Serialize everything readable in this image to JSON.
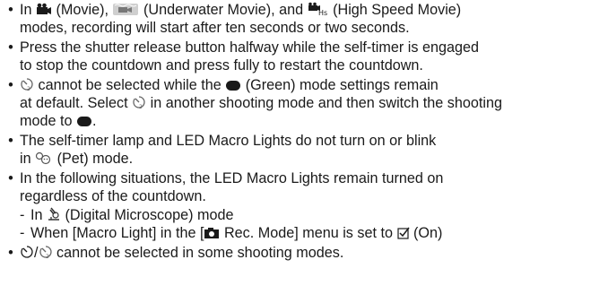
{
  "notes": {
    "bullet_char": "•",
    "dash_char": "-",
    "item1": {
      "a": "In",
      "b": "(Movie),",
      "c": "(Underwater Movie), and",
      "d": "(High Speed Movie)",
      "line2": "modes, recording will start after ten seconds or two seconds."
    },
    "item2": {
      "line1": "Press the shutter release button halfway while the self-timer is engaged",
      "line2": "to stop the countdown and press fully to restart the countdown."
    },
    "item3": {
      "a": "cannot be selected while the",
      "b": "(Green) mode settings remain",
      "line2": "at default. Select",
      "line2b": "in another shooting mode and then switch the shooting",
      "line3": "mode to",
      "line3b": "."
    },
    "item4": {
      "line1": "The self-timer lamp and LED Macro Lights do not turn on or blink",
      "line2a": "in",
      "line2b": "(Pet) mode."
    },
    "item5": {
      "line1": "In the following situations, the LED Macro Lights remain turned on",
      "line2": "regardless of the countdown.",
      "sub1a": "In",
      "sub1b": "(Digital Microscope) mode",
      "sub2a": "When [Macro Light] in the [",
      "sub2b": "Rec. Mode] menu is set to",
      "sub2c": "(On)"
    },
    "item6": {
      "a": "/",
      "b": "cannot be selected in some shooting modes."
    }
  },
  "icons": {
    "movie": "movie-camera-icon",
    "underwater_movie": "underwater-movie-icon",
    "high_speed_movie": "high-speed-movie-icon",
    "self_timer_2s": "self-timer-2s-icon",
    "green_mode": "green-mode-icon",
    "pet_mode": "pet-mode-icon",
    "digital_microscope": "digital-microscope-icon",
    "camera": "camera-icon",
    "checkbox_on": "checkbox-checked-icon",
    "self_timer_10s": "self-timer-10s-icon",
    "text_color": "#1a1a1a"
  }
}
